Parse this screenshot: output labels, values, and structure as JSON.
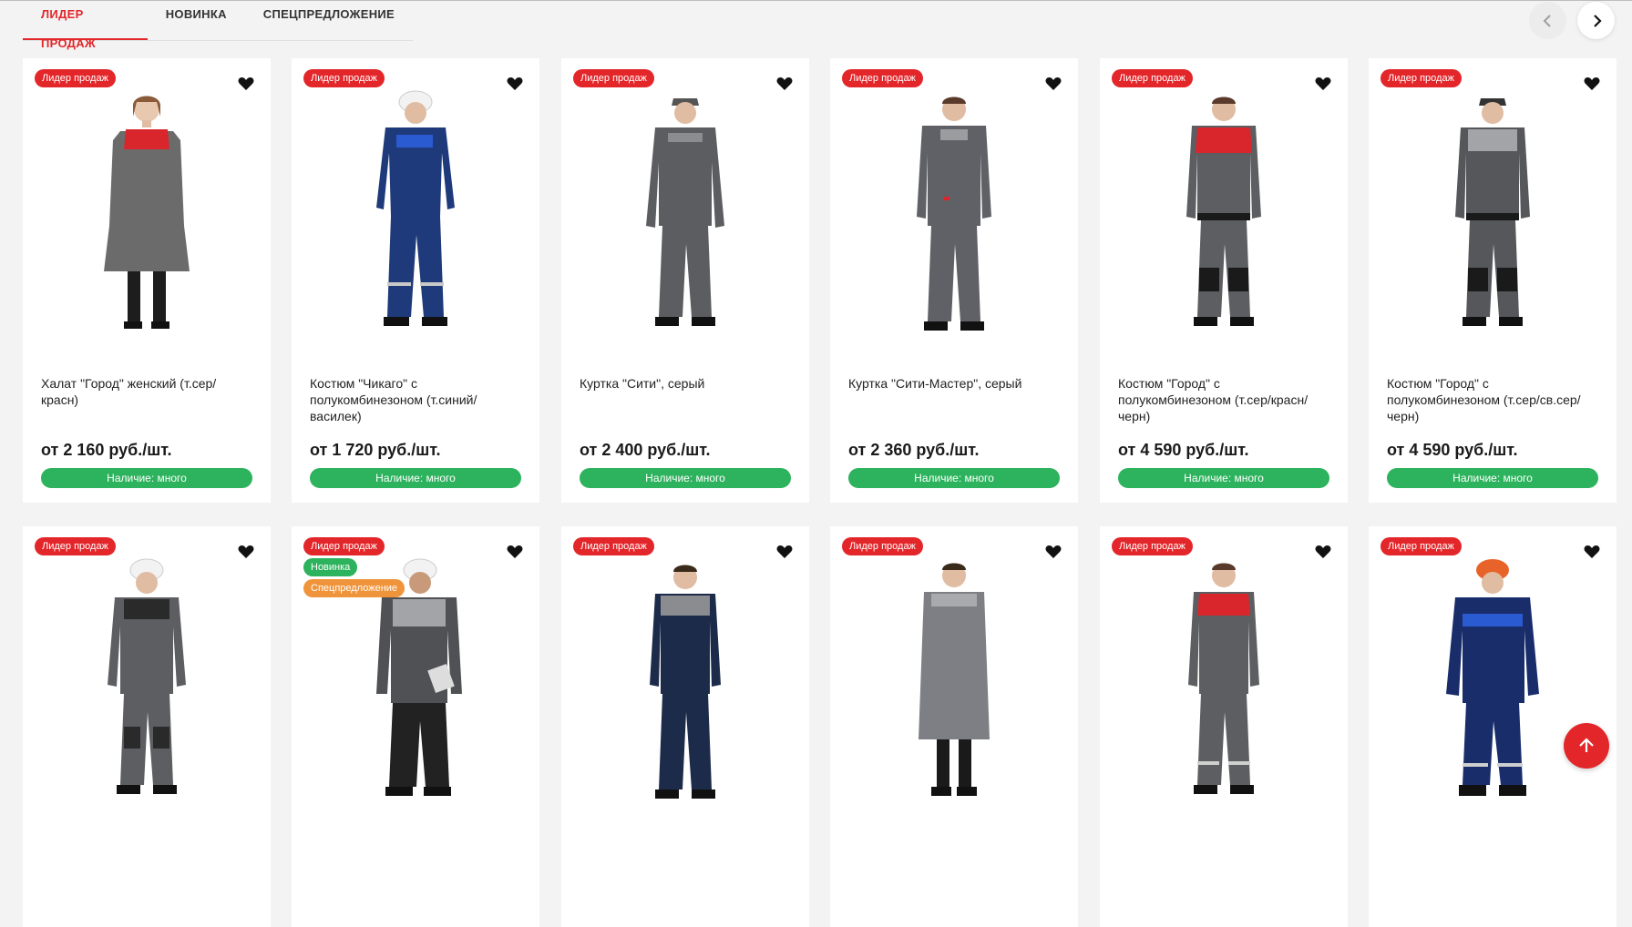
{
  "tabs": [
    "ЛИДЕР ПРОДАЖ",
    "НОВИНКА",
    "СПЕЦПРЕДЛОЖЕНИЕ"
  ],
  "colors": {
    "accent": "#e3262a",
    "stock": "#2db35d",
    "special": "#f0943b"
  },
  "icons": {
    "prev": "chevron-left-icon",
    "next": "chevron-right-icon",
    "favorite": "heart-icon",
    "scroll_top": "arrow-up-icon"
  },
  "row1": [
    {
      "badges": [
        "Лидер продаж"
      ],
      "title": "Халат \"Город\" женский (т.сер/красн)",
      "price": "от 2 160 руб./шт.",
      "stock": "Наличие: много"
    },
    {
      "badges": [
        "Лидер продаж"
      ],
      "title": "Костюм \"Чикаго\" с полукомбинезоном (т.синий/василек)",
      "price": "от 1 720 руб./шт.",
      "stock": "Наличие: много"
    },
    {
      "badges": [
        "Лидер продаж"
      ],
      "title": "Куртка \"Сити\", серый",
      "price": "от 2 400 руб./шт.",
      "stock": "Наличие: много"
    },
    {
      "badges": [
        "Лидер продаж"
      ],
      "title": "Куртка \"Сити-Мастер\", серый",
      "price": "от 2 360 руб./шт.",
      "stock": "Наличие: много"
    },
    {
      "badges": [
        "Лидер продаж"
      ],
      "title": "Костюм \"Город\" с полукомбинезоном (т.сер/красн/черн)",
      "price": "от 4 590 руб./шт.",
      "stock": "Наличие: много"
    },
    {
      "badges": [
        "Лидер продаж"
      ],
      "title": "Костюм \"Город\" с полукомбинезоном (т.сер/св.сер/черн)",
      "price": "от 4 590 руб./шт.",
      "stock": "Наличие: много"
    }
  ],
  "row2": [
    {
      "badges": [
        "Лидер продаж"
      ]
    },
    {
      "badges": [
        "Лидер продаж",
        "Новинка",
        "Спецпредложение"
      ]
    },
    {
      "badges": [
        "Лидер продаж"
      ]
    },
    {
      "badges": [
        "Лидер продаж"
      ]
    },
    {
      "badges": [
        "Лидер продаж"
      ]
    },
    {
      "badges": [
        "Лидер продаж"
      ]
    }
  ]
}
